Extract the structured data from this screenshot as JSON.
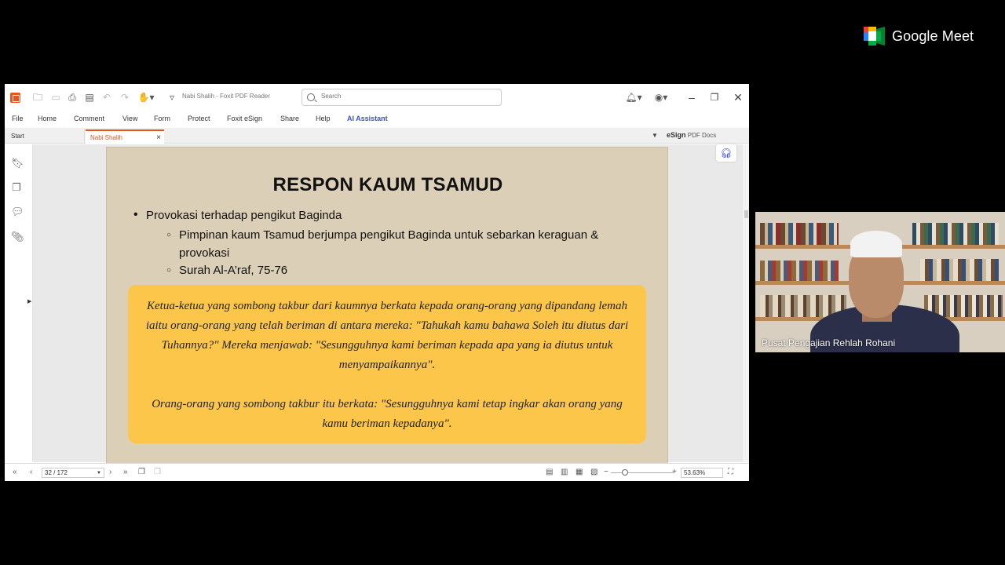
{
  "meet": {
    "brand": "Google Meet"
  },
  "app": {
    "doc_title": "Nabi Shalih - Foxit PDF Reader",
    "search_placeholder": "Search",
    "menu": [
      "File",
      "Home",
      "Comment",
      "View",
      "Form",
      "Protect",
      "Foxit eSign",
      "Share",
      "Help",
      "AI Assistant"
    ],
    "tabs": {
      "start": "Start",
      "active": "Nabi Shalih"
    },
    "esign_bold": "eSign",
    "esign_rest": " PDF Docs"
  },
  "slide": {
    "title": "RESPON KAUM TSAMUD",
    "bullet1": "Provokasi terhadap pengikut Baginda",
    "sub1": "Pimpinan kaum Tsamud berjumpa pengikut Baginda untuk sebarkan keraguan & provokasi",
    "sub2": "Surah Al-A’raf, 75-76",
    "quote1": "Ketua-ketua yang sombong takbur dari kaumnya berkata kepada orang-orang yang dipandang lemah iaitu orang-orang yang telah beriman di antara mereka: \"Tahukah kamu bahawa Soleh itu diutus dari Tuhannya?\" Mereka menjawab: \"Sesungguhnya kami beriman kepada apa yang ia diutus untuk menyampaikannya\".",
    "quote2": "Orang-orang yang sombong takbur itu berkata: \"Sesungguhnya kami tetap ingkar akan orang yang kamu beriman kepadanya\"."
  },
  "status": {
    "page": "32 / 172",
    "zoom": "53.63%"
  },
  "participant": {
    "name": "Pusat Pengajian Rehlah Rohani"
  },
  "colors": {
    "slide_bg": "#dbcfb7",
    "quote_bg": "#fbc64a",
    "accent": "#e8541c",
    "ai": "#3a50d9"
  }
}
